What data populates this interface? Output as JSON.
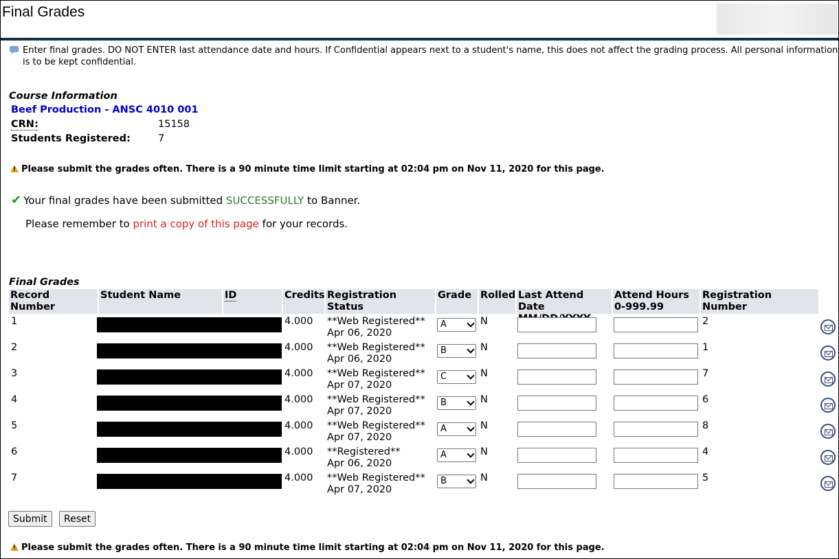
{
  "page": {
    "title": "Final Grades",
    "info_line1": "Enter final grades. DO NOT ENTER last attendance date and hours. If Confidential appears next to a student's name, this does not affect the grading process. All personal information",
    "info_line2": "is to be kept confidential."
  },
  "course": {
    "header": "Course Information",
    "name": "Beef Production - ANSC 4010 001",
    "crn_label": "CRN:",
    "crn": "15158",
    "students_label": "Students Registered:",
    "students": "7"
  },
  "warning": "Please submit the grades often. There is a 90 minute time limit starting at 02:04 pm on Nov 11, 2020 for this page.",
  "success": {
    "prefix": "Your final grades have been submitted ",
    "status": "SUCCESSFULLY",
    "suffix": " to Banner.",
    "remember_prefix": "Please remember to ",
    "print_link": "print a copy of this page",
    "remember_suffix": " for your records."
  },
  "grades": {
    "header": "Final Grades",
    "columns": {
      "record": "Record Number",
      "student": "Student Name",
      "id": "ID",
      "credits": "Credits",
      "status": "Registration Status",
      "grade": "Grade",
      "rolled": "Rolled",
      "last_attend_1": "Last Attend Date",
      "last_attend_2": "MM/DD/YYYY",
      "hours_1": "Attend Hours",
      "hours_2": "0-999.99",
      "reg_number": "Registration Number"
    },
    "rows": [
      {
        "record": "1",
        "credits": "4.000",
        "status": "**Web Registered**",
        "date": "Apr 06, 2020",
        "grade": "A",
        "rolled": "N",
        "reg": "2"
      },
      {
        "record": "2",
        "credits": "4.000",
        "status": "**Web Registered**",
        "date": "Apr 06, 2020",
        "grade": "B",
        "rolled": "N",
        "reg": "1"
      },
      {
        "record": "3",
        "credits": "4.000",
        "status": "**Web Registered**",
        "date": "Apr 07, 2020",
        "grade": "C",
        "rolled": "N",
        "reg": "7"
      },
      {
        "record": "4",
        "credits": "4.000",
        "status": "**Web Registered**",
        "date": "Apr 07, 2020",
        "grade": "B",
        "rolled": "N",
        "reg": "6"
      },
      {
        "record": "5",
        "credits": "4.000",
        "status": "**Web Registered**",
        "date": "Apr 07, 2020",
        "grade": "A",
        "rolled": "N",
        "reg": "8"
      },
      {
        "record": "6",
        "credits": "4.000",
        "status": "**Registered**",
        "date": "Apr 06, 2020",
        "grade": "A",
        "rolled": "N",
        "reg": "4"
      },
      {
        "record": "7",
        "credits": "4.000",
        "status": "**Web Registered**",
        "date": "Apr 07, 2020",
        "grade": "B",
        "rolled": "N",
        "reg": "5"
      }
    ]
  },
  "buttons": {
    "submit": "Submit",
    "reset": "Reset"
  },
  "colors": {
    "header_bar": "#143049",
    "link": "#0000cc",
    "success": "#2a7d2a",
    "print_link": "#d9241b",
    "table_header": "#e2e4ec"
  }
}
